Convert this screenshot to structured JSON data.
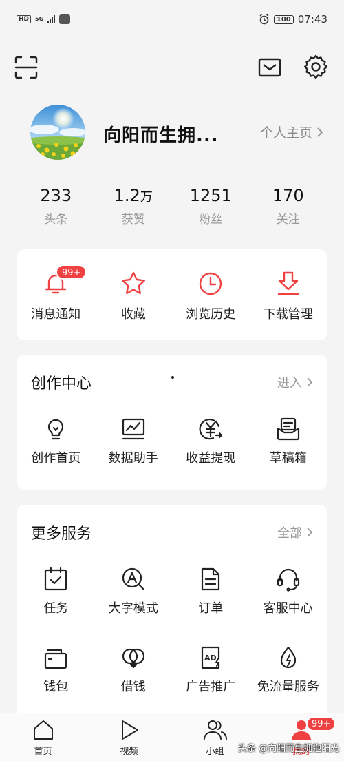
{
  "status_bar": {
    "hd": "HD",
    "network": "5G",
    "time": "07:43",
    "battery": "100"
  },
  "profile": {
    "username": "向阳而生拥...",
    "homepage_link": "个人主页"
  },
  "stats": [
    {
      "value": "233",
      "unit": "",
      "label": "头条"
    },
    {
      "value": "1.2",
      "unit": "万",
      "label": "获赞"
    },
    {
      "value": "1251",
      "unit": "",
      "label": "粉丝"
    },
    {
      "value": "170",
      "unit": "",
      "label": "关注"
    }
  ],
  "quick_actions": [
    {
      "label": "消息通知",
      "icon": "bell-icon",
      "badge": "99+"
    },
    {
      "label": "收藏",
      "icon": "star-icon"
    },
    {
      "label": "浏览历史",
      "icon": "clock-icon"
    },
    {
      "label": "下载管理",
      "icon": "download-icon"
    }
  ],
  "creator_center": {
    "title": "创作中心",
    "more": "进入",
    "items": [
      {
        "label": "创作首页",
        "icon": "lightbulb-icon"
      },
      {
        "label": "数据助手",
        "icon": "chart-monitor-icon"
      },
      {
        "label": "收益提现",
        "icon": "yuan-icon"
      },
      {
        "label": "草稿箱",
        "icon": "draft-box-icon"
      }
    ]
  },
  "more_services": {
    "title": "更多服务",
    "more": "全部",
    "items": [
      {
        "label": "任务",
        "icon": "task-calendar-icon"
      },
      {
        "label": "大字模式",
        "icon": "large-font-icon"
      },
      {
        "label": "订单",
        "icon": "order-doc-icon"
      },
      {
        "label": "客服中心",
        "icon": "headset-icon"
      },
      {
        "label": "钱包",
        "icon": "wallet-icon"
      },
      {
        "label": "借钱",
        "icon": "loan-icon"
      },
      {
        "label": "广告推广",
        "icon": "ad-icon"
      },
      {
        "label": "免流量服务",
        "icon": "data-free-icon"
      }
    ]
  },
  "tab_bar": {
    "tabs": [
      {
        "label": "首页",
        "icon": "home-icon"
      },
      {
        "label": "视频",
        "icon": "play-icon"
      },
      {
        "label": "小组",
        "icon": "group-icon"
      },
      {
        "label": "我的",
        "icon": "user-icon",
        "badge": "99+"
      }
    ]
  },
  "watermark": "头条 @向阳而生拥抱阳光",
  "colors": {
    "accent": "#f04142",
    "background": "#f4f4f4",
    "card": "#ffffff"
  }
}
